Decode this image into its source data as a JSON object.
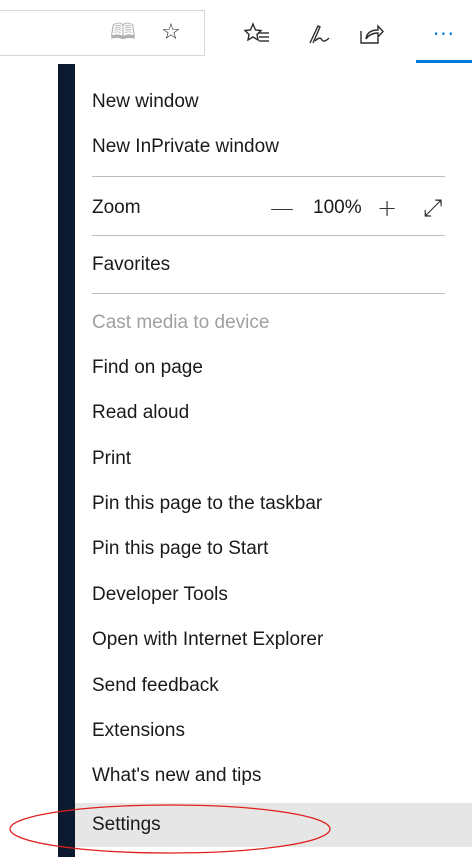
{
  "toolbar": {
    "icons": [
      "reading-view-icon",
      "favorite-star-icon",
      "favorites-hub-icon",
      "web-note-icon",
      "share-icon"
    ],
    "more_label": "···"
  },
  "menu": {
    "items": [
      {
        "label": "New window"
      },
      {
        "label": "New InPrivate window"
      },
      {
        "label": "Zoom"
      },
      {
        "label": "Favorites"
      },
      {
        "label": "Cast media to device",
        "disabled": true
      },
      {
        "label": "Find on page"
      },
      {
        "label": "Read aloud"
      },
      {
        "label": "Print"
      },
      {
        "label": "Pin this page to the taskbar"
      },
      {
        "label": "Pin this page to Start"
      },
      {
        "label": "Developer Tools"
      },
      {
        "label": "Open with Internet Explorer"
      },
      {
        "label": "Send feedback"
      },
      {
        "label": "Extensions"
      },
      {
        "label": "What's new and tips"
      },
      {
        "label": "Settings",
        "highlighted": true
      }
    ],
    "zoom": {
      "minus": "—",
      "value": "100%",
      "plus": "+",
      "fullscreen": "⤢"
    }
  },
  "colors": {
    "accent": "#0078d7",
    "menu_bar": "#0c1a30",
    "annotation": "#e0201e",
    "highlight": "#e6e6e6",
    "disabled": "#a0a0a0"
  }
}
